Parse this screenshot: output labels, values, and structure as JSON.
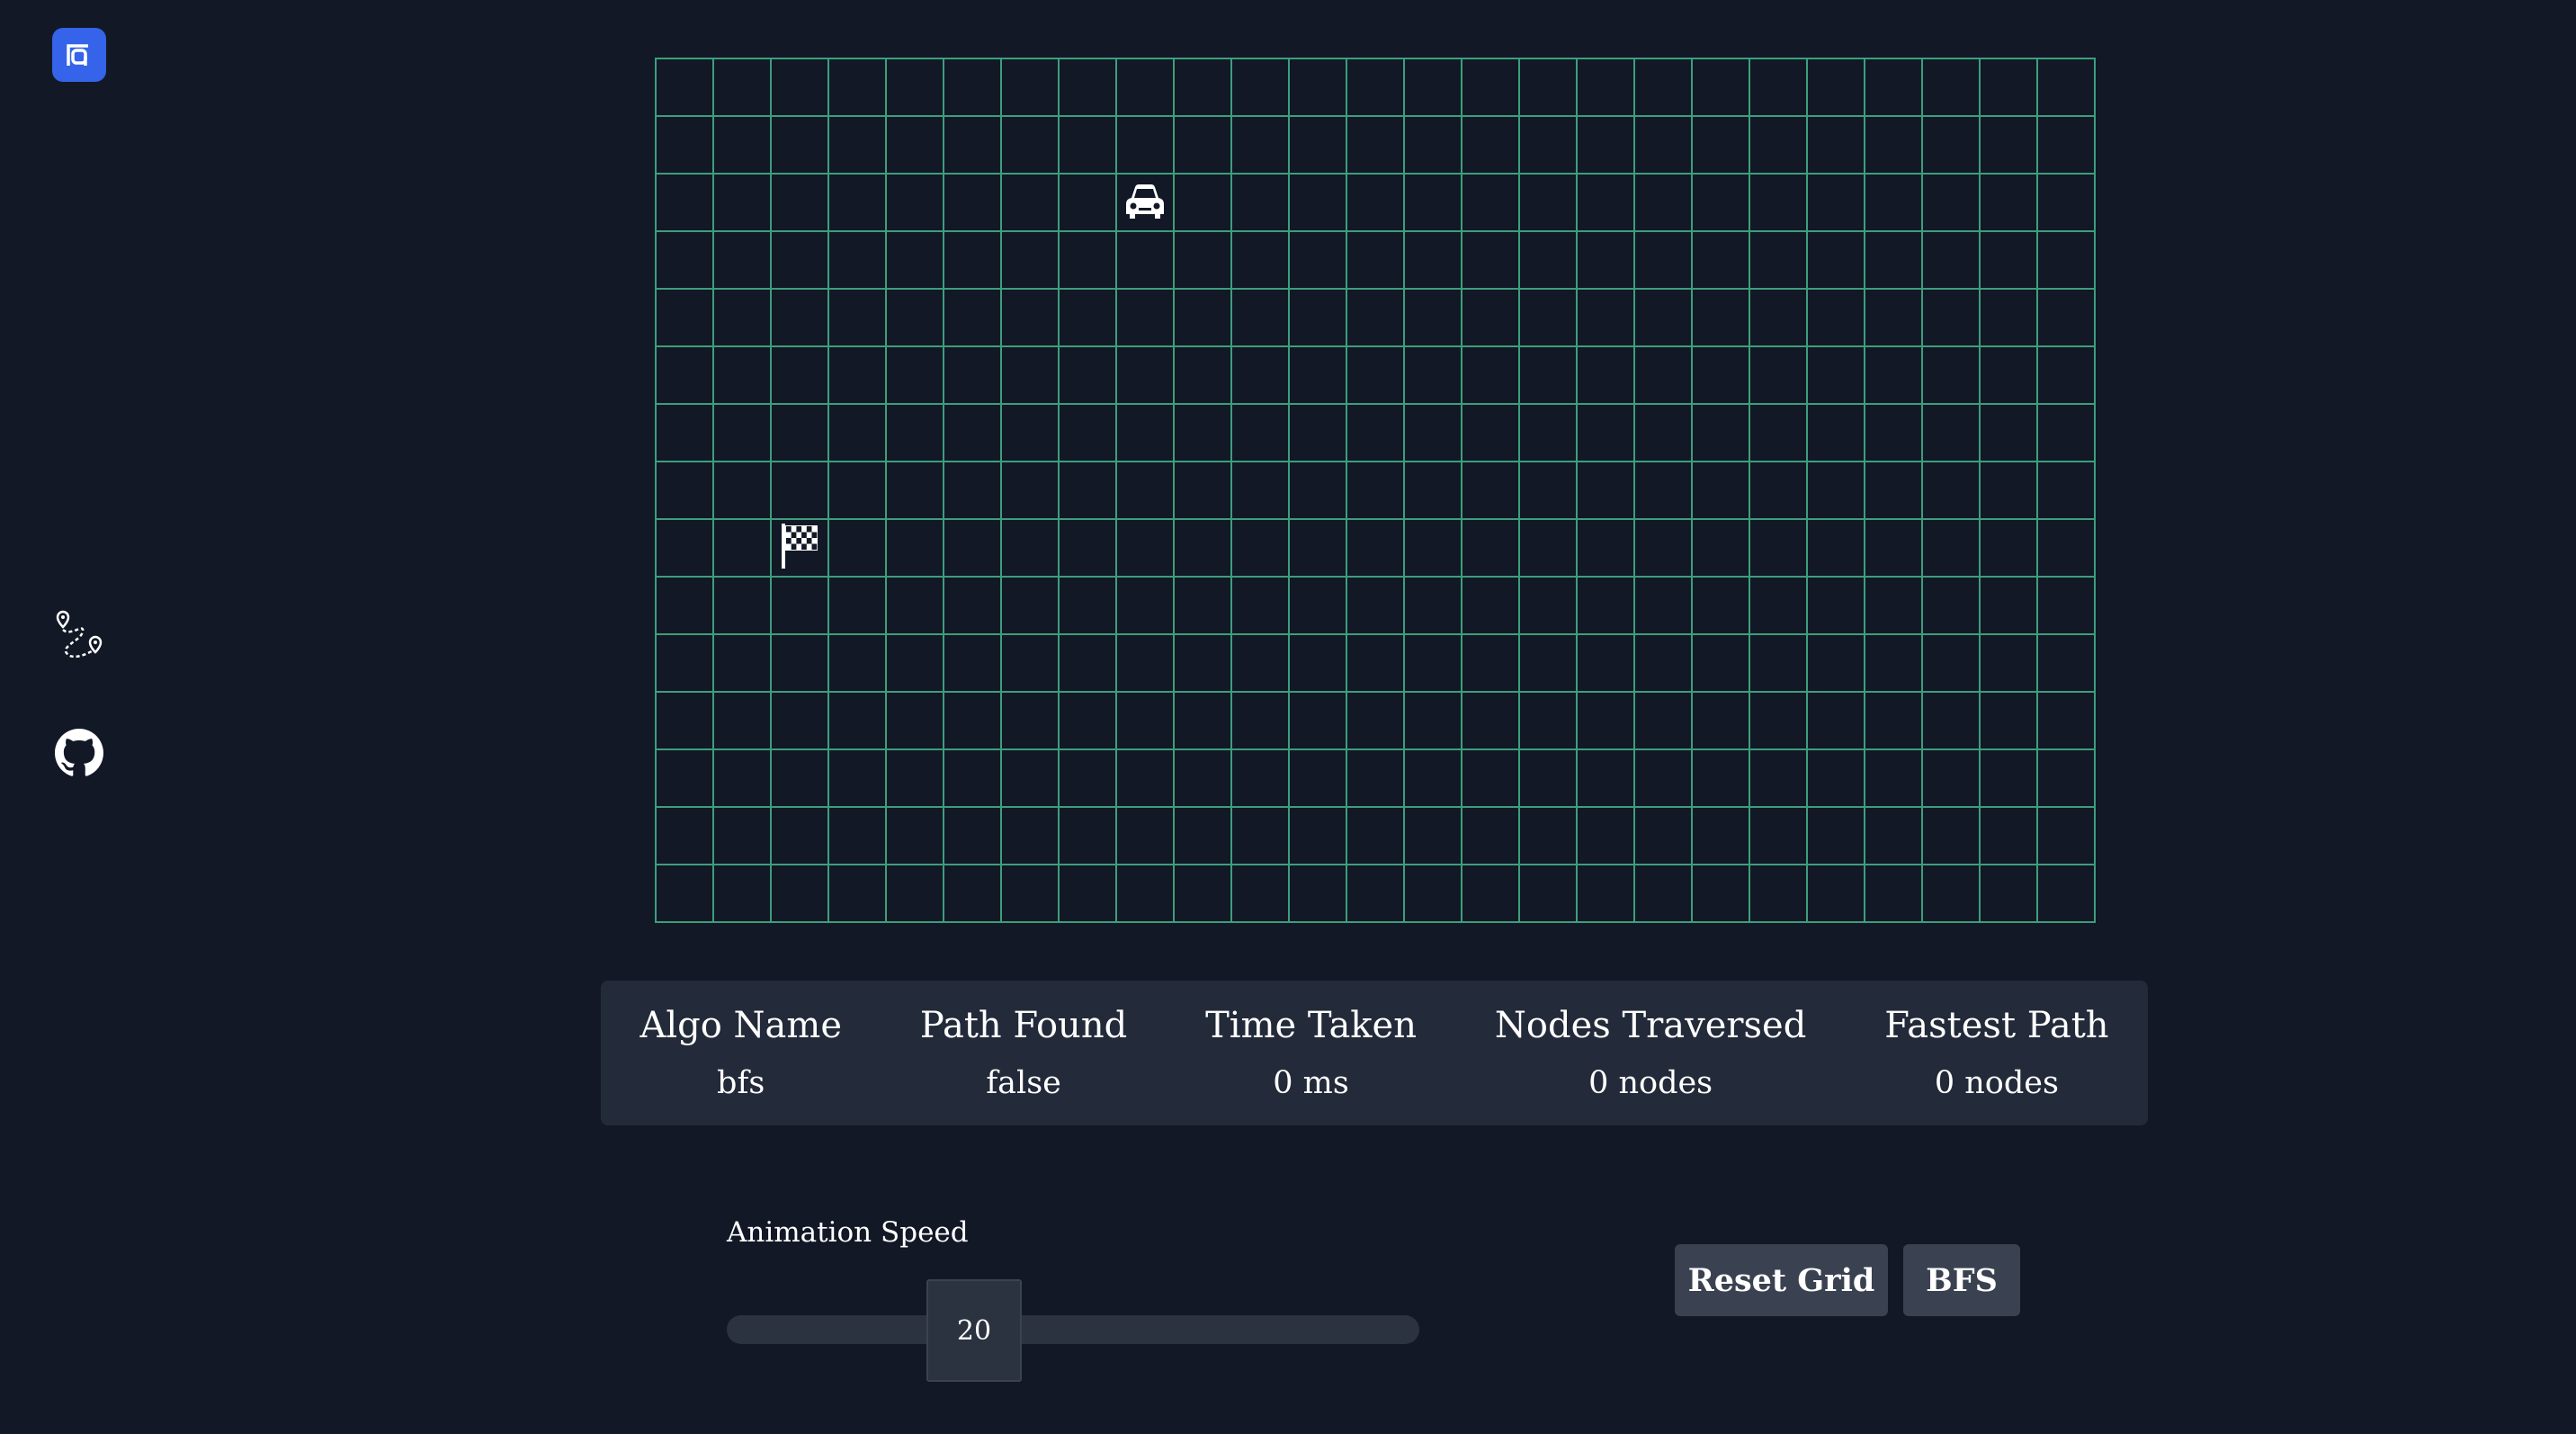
{
  "sidebar": {
    "logo_icon": "app-logo-icon",
    "items": [
      {
        "icon": "route-map-icon",
        "name": "routes"
      },
      {
        "icon": "github-icon",
        "name": "github"
      }
    ]
  },
  "grid": {
    "rows": 15,
    "cols": 25,
    "line_color": "#3d9e7c",
    "start": {
      "row": 2,
      "col": 8,
      "icon": "car-icon"
    },
    "finish": {
      "row": 8,
      "col": 2,
      "icon": "checkered-flag-icon"
    }
  },
  "stats": [
    {
      "label": "Algo Name",
      "value": "bfs"
    },
    {
      "label": "Path Found",
      "value": "false"
    },
    {
      "label": "Time Taken",
      "value": "0 ms"
    },
    {
      "label": "Nodes Traversed",
      "value": "0 nodes"
    },
    {
      "label": "Fastest Path",
      "value": "0 nodes"
    }
  ],
  "speed": {
    "label": "Animation Speed",
    "value": "20"
  },
  "buttons": {
    "reset": "Reset Grid",
    "algo": "BFS"
  },
  "colors": {
    "background": "#121826",
    "accent": "#3563e9",
    "panel": "#232a39",
    "button": "#3a4150"
  }
}
